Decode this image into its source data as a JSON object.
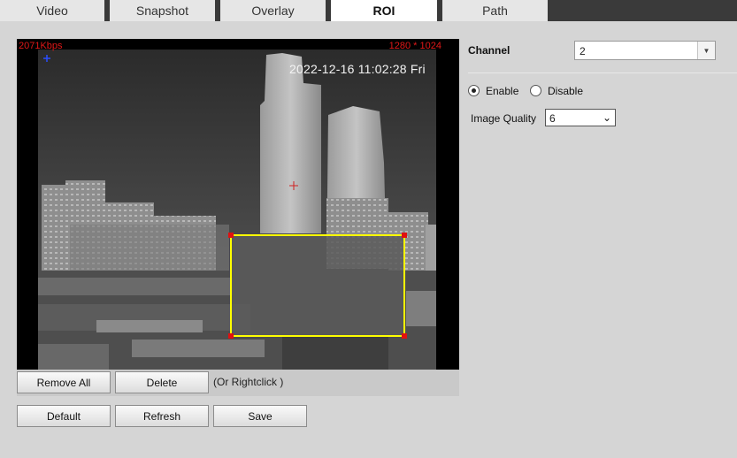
{
  "tabs": [
    {
      "label": "Video"
    },
    {
      "label": "Snapshot"
    },
    {
      "label": "Overlay"
    },
    {
      "label": "ROI"
    },
    {
      "label": "Path"
    }
  ],
  "active_tab": "ROI",
  "video": {
    "bitrate": "2071Kbps",
    "resolution": "1280 * 1024",
    "timestamp": "2022-12-16 11:02:28 Fri",
    "roi_color": "#ffff00",
    "handle_color": "#e01010"
  },
  "video_buttons": {
    "remove_all": "Remove All",
    "delete": "Delete",
    "hint": "(Or Rightclick )"
  },
  "actions": {
    "default": "Default",
    "refresh": "Refresh",
    "save": "Save"
  },
  "panel": {
    "channel_label": "Channel",
    "channel_value": "2",
    "enable_label": "Enable",
    "disable_label": "Disable",
    "enabled": true,
    "quality_label": "Image Quality",
    "quality_value": "6"
  }
}
